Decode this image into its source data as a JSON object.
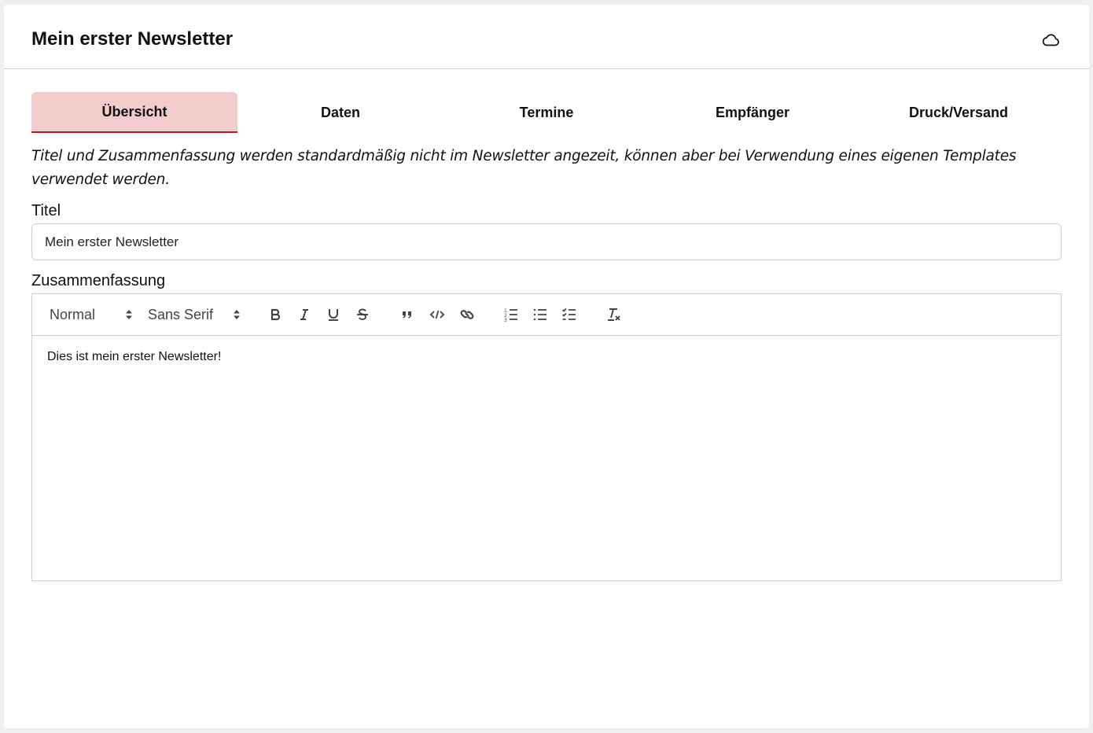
{
  "header": {
    "title": "Mein erster Newsletter"
  },
  "tabs": [
    {
      "label": "Übersicht",
      "active": true
    },
    {
      "label": "Daten",
      "active": false
    },
    {
      "label": "Termine",
      "active": false
    },
    {
      "label": "Empfänger",
      "active": false
    },
    {
      "label": "Druck/Versand",
      "active": false
    }
  ],
  "info_text": "Titel und Zusammenfassung werden standardmäßig nicht im Newsletter angezeit, können aber bei Verwendung eines eigenen Templates verwendet werden.",
  "title_field": {
    "label": "Titel",
    "value": "Mein erster Newsletter"
  },
  "summary_field": {
    "label": "Zusammenfassung",
    "toolbar": {
      "header_select": "Normal",
      "font_select": "Sans Serif",
      "buttons": [
        "bold-icon",
        "italic-icon",
        "underline-icon",
        "strike-icon",
        "blockquote-icon",
        "code-icon",
        "link-icon",
        "ordered-list-icon",
        "bullet-list-icon",
        "check-list-icon",
        "clear-format-icon"
      ]
    },
    "content": "Dies ist mein erster Newsletter!"
  },
  "colors": {
    "active_tab_bg": "#f2cbcb",
    "active_tab_border": "#b22222"
  }
}
